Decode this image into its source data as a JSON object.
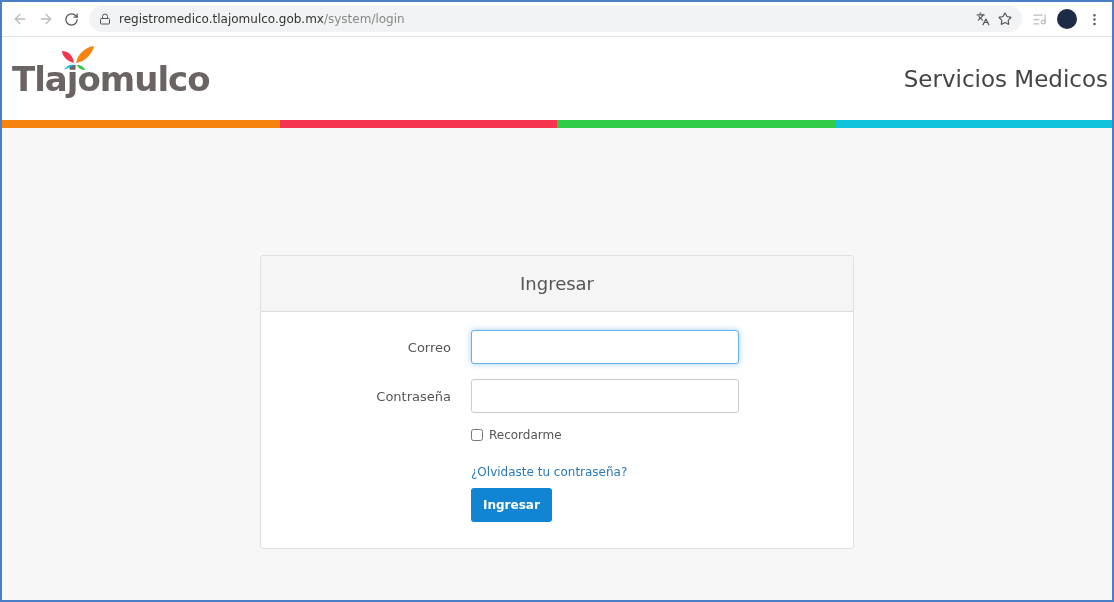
{
  "browser": {
    "url_host": "registromedico.tlajomulco.gob.mx",
    "url_path": "/system/login"
  },
  "header": {
    "logo": "Tlajomulco",
    "title": "Servicios Medicos"
  },
  "login": {
    "title": "Ingresar",
    "fields": [
      {
        "label": "Correo",
        "focused": true
      },
      {
        "label": "Contraseña",
        "focused": false
      }
    ],
    "remember": {
      "label": "Recordarme",
      "checked": false
    },
    "forgot_link": "¿Olvidaste tu contraseña?",
    "submit": "Ingresar"
  }
}
